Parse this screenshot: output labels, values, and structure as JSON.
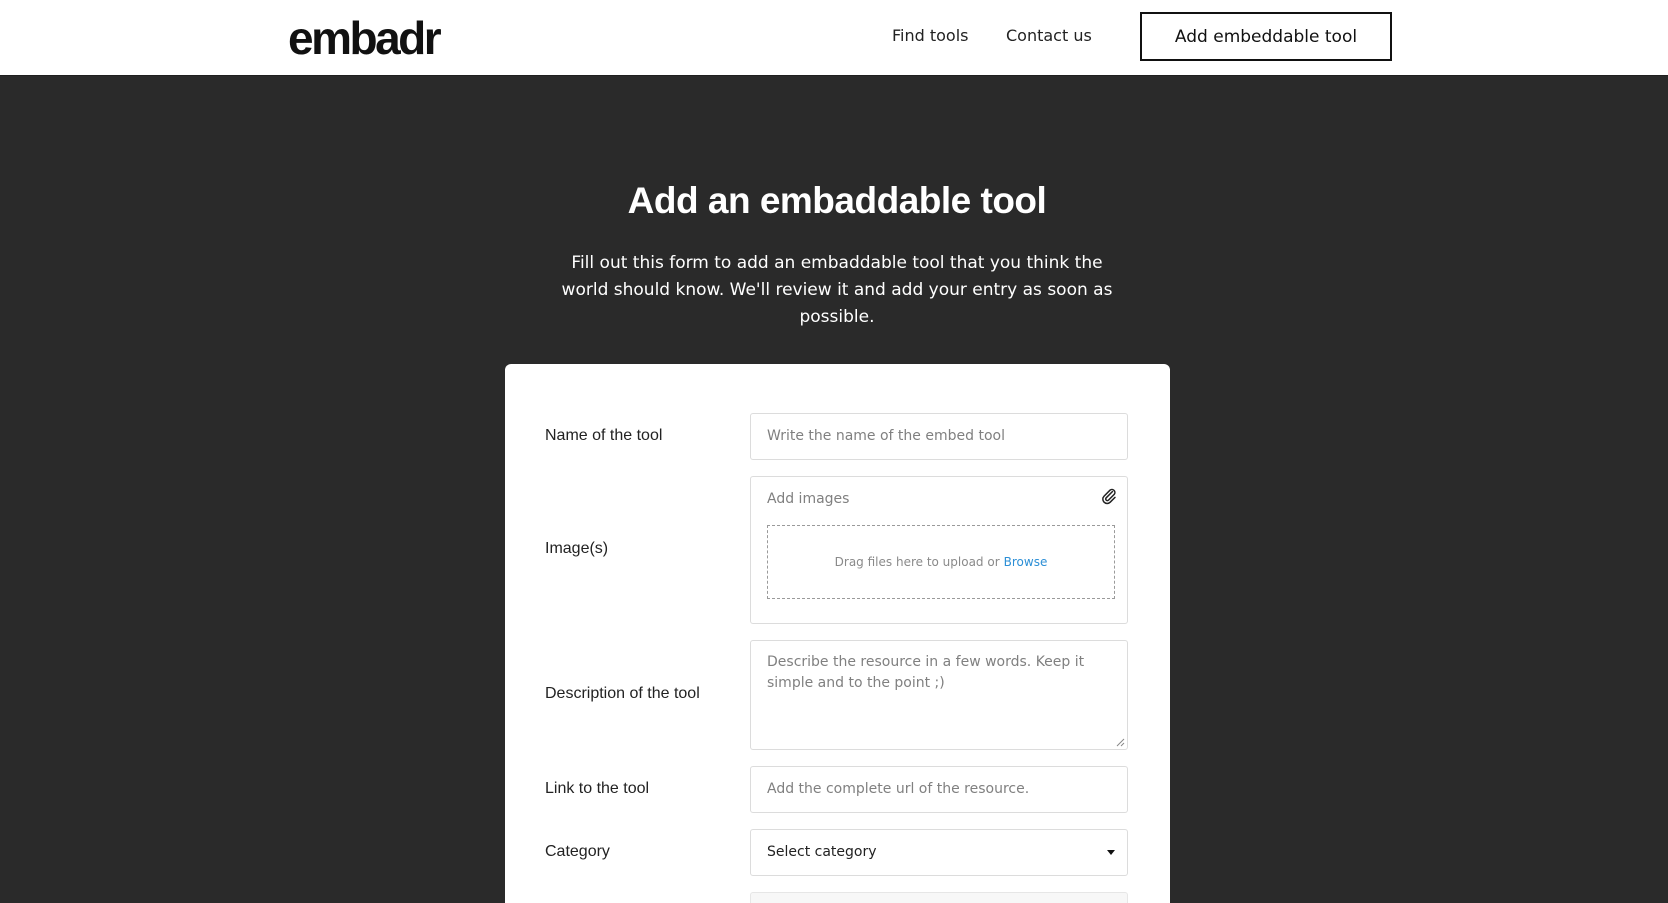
{
  "header": {
    "logo": "embadr",
    "nav": [
      "Find tools",
      "Contact us"
    ],
    "cta_label": "Add embeddable tool"
  },
  "hero": {
    "title": "Add an embaddable tool",
    "subtitle": "Fill out this form to add an embaddable tool that you think the world should know. We'll review it and add your entry as soon as possible."
  },
  "form": {
    "name": {
      "label": "Name of the tool",
      "placeholder": "Write the name of the embed tool"
    },
    "images": {
      "label": "Image(s)",
      "placeholder": "Add images",
      "drop_text": "Drag files here to upload or",
      "browse_label": "Browse",
      "icon": "paperclip-icon"
    },
    "description": {
      "label": "Description of the tool",
      "placeholder": "Describe the resource in a few words. Keep it simple and to the point ;)"
    },
    "link": {
      "label": "Link to the tool",
      "placeholder": "Add the complete url of the resource."
    },
    "category": {
      "label": "Category",
      "selected": "Select category",
      "icon": "caret-down-icon"
    }
  },
  "colors": {
    "page_background": "#2a2a2a",
    "card_background": "#ffffff",
    "link_accent": "#2c8fd6"
  }
}
